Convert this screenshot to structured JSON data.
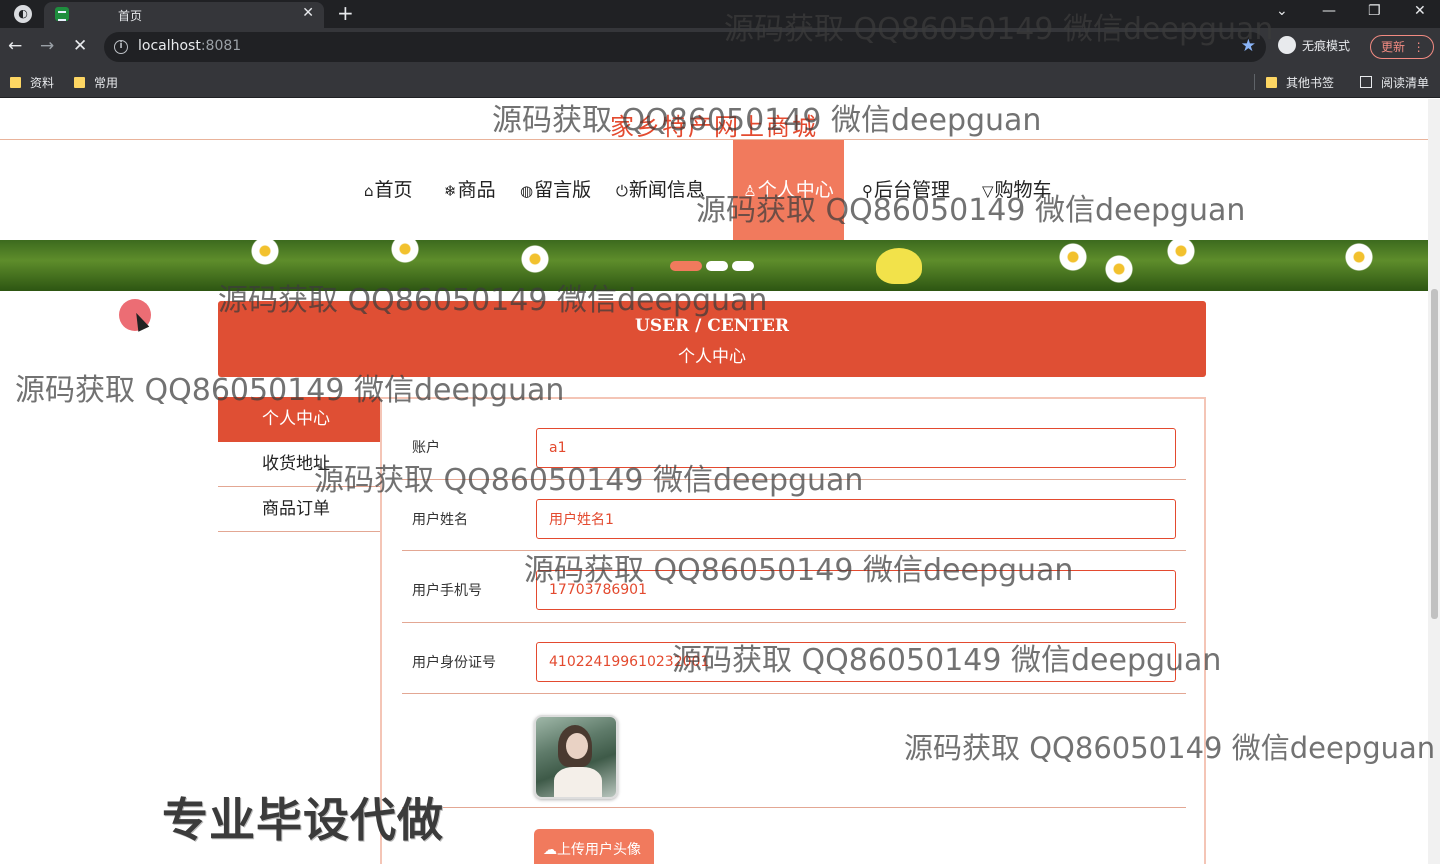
{
  "browser": {
    "tab_title": "首页",
    "url_host": "localhost",
    "url_port": ":8081",
    "incognito_label": "无痕模式",
    "update_label": "更新",
    "bookmarks": [
      "资料",
      "常用"
    ],
    "other_bookmarks": "其他书签",
    "reading_list": "阅读清单"
  },
  "site": {
    "title": "家乡特产网上商城",
    "nav": [
      {
        "icon": "⌂",
        "label": "首页"
      },
      {
        "icon": "❄",
        "label": "商品"
      },
      {
        "icon": "◍",
        "label": "留言版"
      },
      {
        "icon": "⏻",
        "label": "新闻信息"
      },
      {
        "icon": "♙",
        "label": "个人中心"
      },
      {
        "icon": "⚲",
        "label": "后台管理"
      },
      {
        "icon": "▽",
        "label": "购物车"
      }
    ],
    "active_nav": "个人中心",
    "carousel_active": 1
  },
  "user_center": {
    "heading_en": "USER / CENTER",
    "heading_zh": "个人中心",
    "sidebar": [
      "个人中心",
      "收货地址",
      "商品订单"
    ],
    "fields": [
      {
        "label": "账户",
        "value": "a1"
      },
      {
        "label": "用户姓名",
        "value": "用户姓名1"
      },
      {
        "label": "用户手机号",
        "value": "17703786901"
      },
      {
        "label": "用户身份证号",
        "value": "410224199610232001"
      }
    ],
    "upload_label": "上传用户头像"
  },
  "overlay": {
    "watermark": "源码获取 QQ86050149 微信deepguan",
    "promo": "专业毕设代做"
  },
  "colors": {
    "accent": "#df4f34",
    "nav_active": "#f17a5d",
    "title_red": "#e34a2f"
  }
}
